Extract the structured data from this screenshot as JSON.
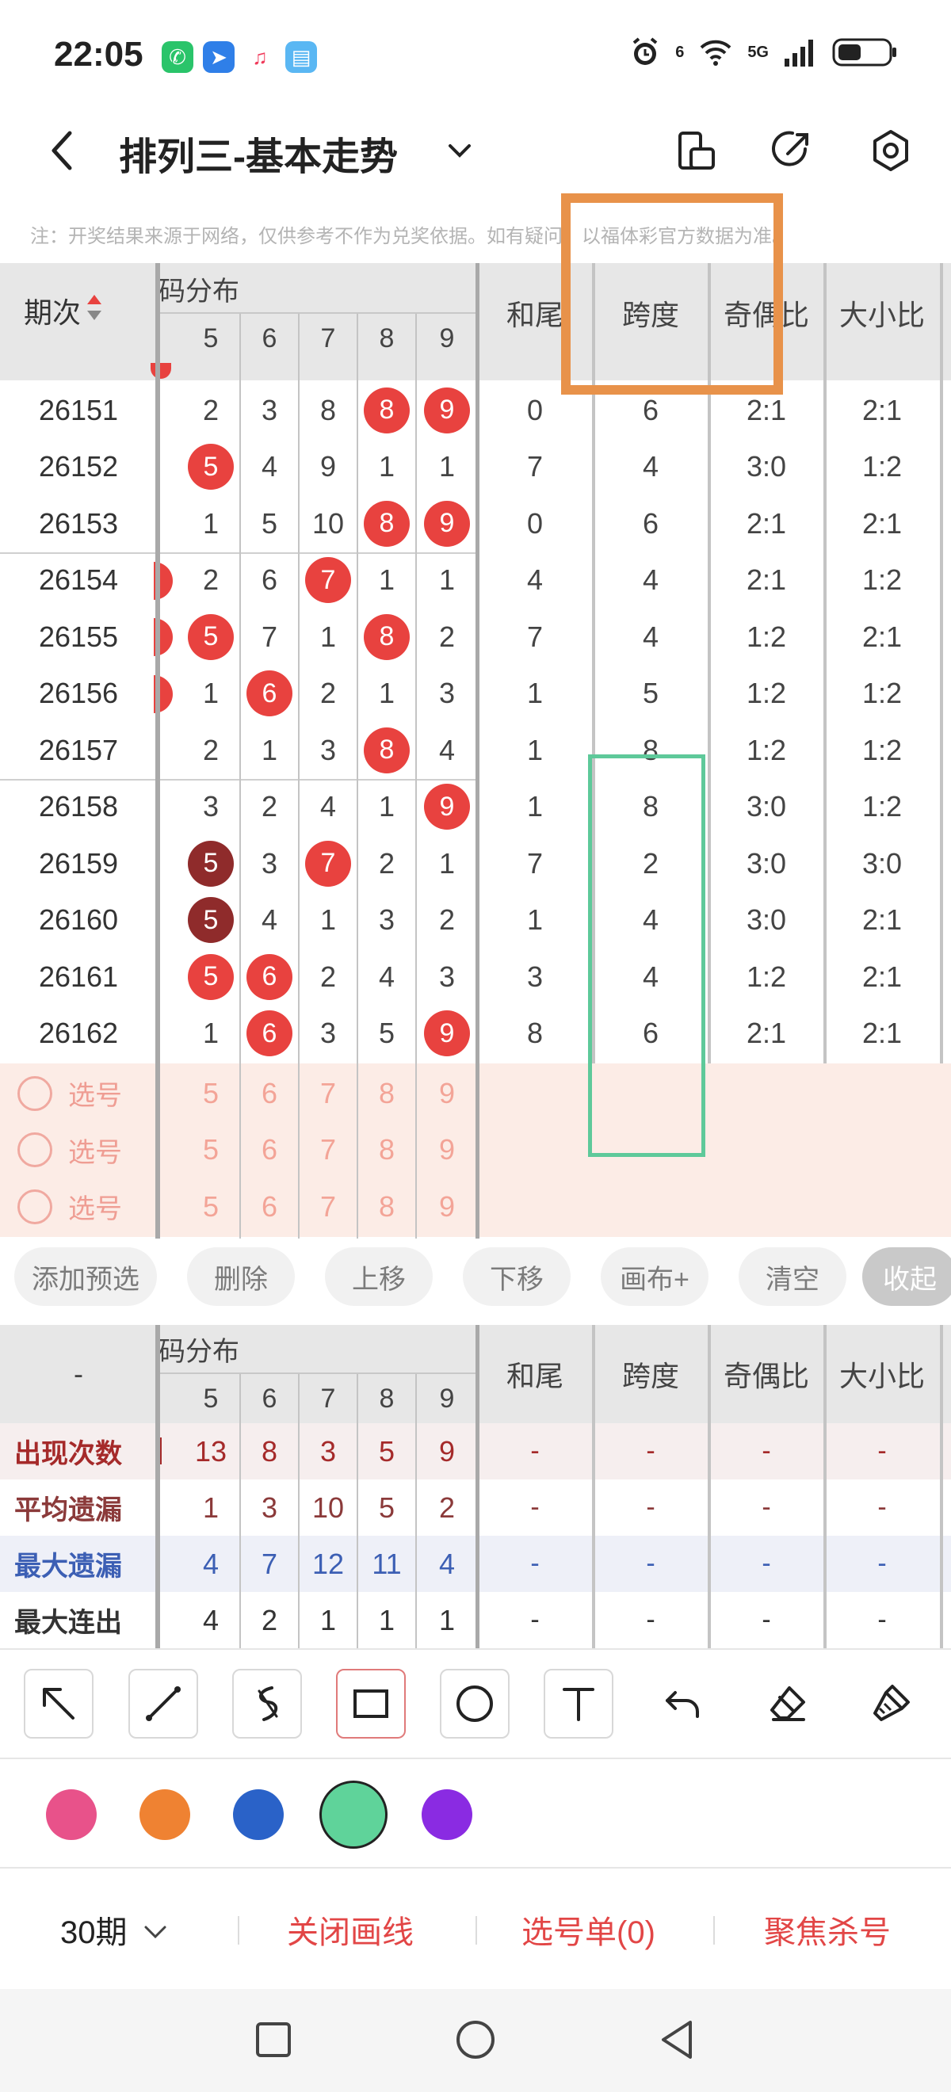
{
  "status": {
    "time": "22:05",
    "network": "5G",
    "signal_small": "6"
  },
  "header": {
    "title": "排列三-基本走势"
  },
  "notice": "注：开奖结果来源于网络，仅供参考不作为兑奖依据。如有疑问，以福体彩官方数据为准。",
  "table": {
    "col_period": "期次",
    "col_group": "号码分布",
    "digits": [
      "5",
      "6",
      "7",
      "8",
      "9"
    ],
    "col_hewei": "和尾",
    "col_kuadu": "跨度",
    "col_jiou": "奇偶比",
    "col_daxiao": "大小比",
    "rows": [
      {
        "period": "26151",
        "d": [
          "2",
          "3",
          "8",
          "8",
          "9"
        ],
        "balls": {
          "8": "red",
          "9": "red"
        },
        "hewei": "0",
        "kuadu": "6",
        "jiou": "2:1",
        "daxiao": "2:1"
      },
      {
        "period": "26152",
        "d": [
          "5",
          "4",
          "9",
          "1",
          "1"
        ],
        "balls": {
          "5": "red"
        },
        "hewei": "7",
        "kuadu": "4",
        "jiou": "3:0",
        "daxiao": "1:2"
      },
      {
        "period": "26153",
        "d": [
          "1",
          "5",
          "10",
          "8",
          "9"
        ],
        "balls": {
          "8": "red",
          "9": "red"
        },
        "hewei": "0",
        "kuadu": "6",
        "jiou": "2:1",
        "daxiao": "2:1"
      },
      {
        "period": "26154",
        "d": [
          "2",
          "6",
          "7",
          "1",
          "1"
        ],
        "balls": {
          "7": "red"
        },
        "hewei": "4",
        "kuadu": "4",
        "jiou": "2:1",
        "daxiao": "1:2"
      },
      {
        "period": "26155",
        "d": [
          "5",
          "7",
          "1",
          "8",
          "2"
        ],
        "balls": {
          "5": "red",
          "8": "red"
        },
        "hewei": "7",
        "kuadu": "4",
        "jiou": "1:2",
        "daxiao": "2:1"
      },
      {
        "period": "26156",
        "d": [
          "1",
          "6",
          "2",
          "1",
          "3"
        ],
        "balls": {
          "6": "red"
        },
        "hewei": "1",
        "kuadu": "5",
        "jiou": "1:2",
        "daxiao": "1:2"
      },
      {
        "period": "26157",
        "d": [
          "2",
          "1",
          "3",
          "8",
          "4"
        ],
        "balls": {
          "8": "red"
        },
        "hewei": "1",
        "kuadu": "8",
        "jiou": "1:2",
        "daxiao": "1:2"
      },
      {
        "period": "26158",
        "d": [
          "3",
          "2",
          "4",
          "1",
          "9"
        ],
        "balls": {
          "9": "red"
        },
        "hewei": "1",
        "kuadu": "8",
        "jiou": "3:0",
        "daxiao": "1:2"
      },
      {
        "period": "26159",
        "d": [
          "5",
          "3",
          "7",
          "2",
          "1"
        ],
        "balls": {
          "5": "dark",
          "7": "red"
        },
        "hewei": "7",
        "kuadu": "2",
        "jiou": "3:0",
        "daxiao": "3:0"
      },
      {
        "period": "26160",
        "d": [
          "5",
          "4",
          "1",
          "3",
          "2"
        ],
        "balls": {
          "5": "dark"
        },
        "hewei": "1",
        "kuadu": "4",
        "jiou": "3:0",
        "daxiao": "2:1"
      },
      {
        "period": "26161",
        "d": [
          "5",
          "6",
          "2",
          "4",
          "3"
        ],
        "balls": {
          "5": "red",
          "6": "red"
        },
        "hewei": "3",
        "kuadu": "4",
        "jiou": "1:2",
        "daxiao": "2:1"
      },
      {
        "period": "26162",
        "d": [
          "1",
          "6",
          "3",
          "5",
          "9"
        ],
        "balls": {
          "6": "red",
          "9": "red"
        },
        "hewei": "8",
        "kuadu": "6",
        "jiou": "2:1",
        "daxiao": "2:1"
      }
    ],
    "select_rows": [
      {
        "label": "选号",
        "digits": [
          "5",
          "6",
          "7",
          "8",
          "9"
        ]
      },
      {
        "label": "选号",
        "digits": [
          "5",
          "6",
          "7",
          "8",
          "9"
        ]
      },
      {
        "label": "选号",
        "digits": [
          "5",
          "6",
          "7",
          "8",
          "9"
        ]
      }
    ]
  },
  "actions": [
    {
      "label": "添加预选",
      "dark": false
    },
    {
      "label": "删除",
      "dark": false
    },
    {
      "label": "上移",
      "dark": false
    },
    {
      "label": "下移",
      "dark": false
    },
    {
      "label": "画布+",
      "dark": false
    },
    {
      "label": "清空",
      "dark": false
    },
    {
      "label": "收起",
      "dark": true
    }
  ],
  "stats": {
    "corner": "-",
    "col_group": "号码分布",
    "digits": [
      "5",
      "6",
      "7",
      "8",
      "9"
    ],
    "col_hewei": "和尾",
    "col_kuadu": "跨度",
    "col_jiou": "奇偶比",
    "col_daxiao": "大小比",
    "rows": [
      {
        "label": "出现次数",
        "color": "#a52a2a",
        "bg": "#f6eeee",
        "values": [
          "13",
          "8",
          "3",
          "5",
          "9"
        ],
        "rest": [
          "-",
          "-",
          "-",
          "-"
        ]
      },
      {
        "label": "平均遗漏",
        "color": "#8b3a3a",
        "bg": "#ffffff",
        "values": [
          "1",
          "3",
          "10",
          "5",
          "2"
        ],
        "rest": [
          "-",
          "-",
          "-",
          "-"
        ]
      },
      {
        "label": "最大遗漏",
        "color": "#3c5fb4",
        "bg": "#eef0f8",
        "values": [
          "4",
          "7",
          "12",
          "11",
          "4"
        ],
        "rest": [
          "-",
          "-",
          "-",
          "-"
        ]
      },
      {
        "label": "最大连出",
        "color": "#333333",
        "bg": "#ffffff",
        "values": [
          "4",
          "2",
          "1",
          "1",
          "1"
        ],
        "rest": [
          "-",
          "-",
          "-",
          "-"
        ]
      }
    ]
  },
  "tools": [
    "arrow-tool",
    "line-tool",
    "curve-tool",
    "rectangle-tool",
    "circle-tool",
    "text-tool",
    "undo-tool",
    "eraser-tool",
    "brush-tool"
  ],
  "colors": [
    "#e8528a",
    "#ef8232",
    "#2a62c8",
    "#5fd39a",
    "#8a2be2"
  ],
  "selected_color": "#5fd39a",
  "bottom": {
    "period_select": "30期",
    "close_lines": "关闭画线",
    "pick_list": "选号单(0)",
    "focus_kill": "聚焦杀号"
  }
}
